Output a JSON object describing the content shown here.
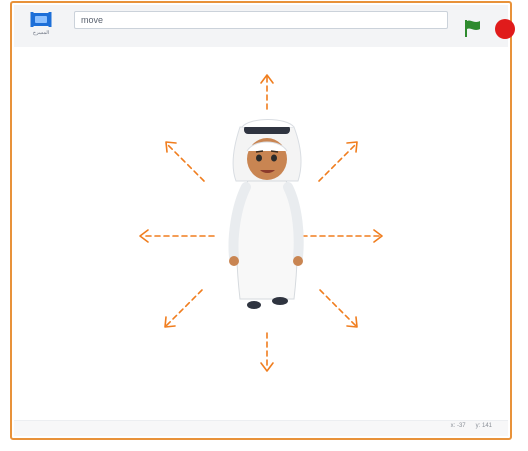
{
  "toolbar": {
    "stage_label": "المسرح",
    "name_value": "move",
    "flag_icon": "green-flag-icon",
    "stop_icon": "stop-icon"
  },
  "status": {
    "x_label": "x:",
    "x_value": "-37",
    "y_label": "y:",
    "y_value": "141"
  },
  "colors": {
    "frame": "#e8923a",
    "arrow": "#f07d1e",
    "flag": "#2e8b2e",
    "stop": "#e01b1b"
  },
  "arrows": [
    "up",
    "up-right",
    "right",
    "down-right",
    "down",
    "down-left",
    "left",
    "up-left"
  ]
}
